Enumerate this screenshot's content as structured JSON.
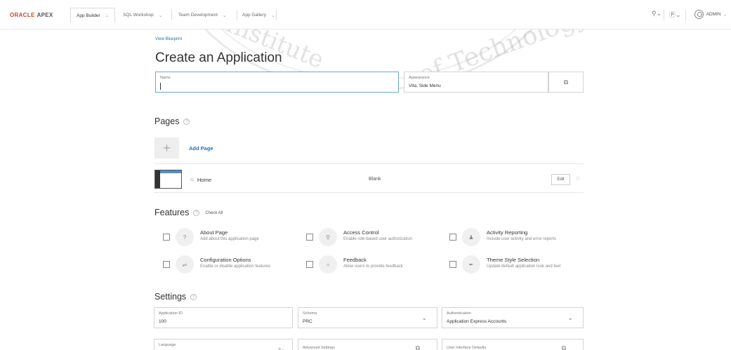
{
  "navbar": {
    "logo": "ORACLE",
    "product": "APEX",
    "tabs": [
      {
        "label": "App Builder",
        "active": true
      },
      {
        "label": "SQL Workshop",
        "active": false
      },
      {
        "label": "Team Development",
        "active": false
      },
      {
        "label": "App Gallery",
        "active": false
      }
    ],
    "user": "ADMIN"
  },
  "watermark": {
    "text_left": "Institute",
    "text_right": "of Technology",
    "small": "s"
  },
  "main": {
    "blueprint_link": "View Blueprint",
    "title": "Create an Application",
    "name_field": {
      "label": "Name",
      "value": ""
    },
    "appearance_field": {
      "label": "Appearance",
      "value": "Vita, Side Menu"
    }
  },
  "pages": {
    "title": "Pages",
    "help": "?",
    "add_label": "Add Page",
    "rows": [
      {
        "name": "Home",
        "type": "Blank",
        "edit_label": "Edit"
      }
    ]
  },
  "features": {
    "title": "Features",
    "help": "?",
    "check_all": "Check All",
    "items": [
      {
        "title": "About Page",
        "desc": "Add about this application page",
        "icon": "question-icon"
      },
      {
        "title": "Access Control",
        "desc": "Enable role-based user authorization",
        "icon": "key-icon"
      },
      {
        "title": "Activity Reporting",
        "desc": "Include user activity and error reports",
        "icon": "user-activity-icon"
      },
      {
        "title": "Configuration Options",
        "desc": "Enable or disable application features",
        "icon": "sliders-icon"
      },
      {
        "title": "Feedback",
        "desc": "Allow users to provide feedback",
        "icon": "comment-icon"
      },
      {
        "title": "Theme Style Selection",
        "desc": "Update default application look and feel",
        "icon": "brush-icon"
      }
    ]
  },
  "settings": {
    "title": "Settings",
    "help": "?",
    "fields": [
      {
        "label": "Application ID",
        "value": "100"
      },
      {
        "label": "Schema",
        "value": "PRC"
      },
      {
        "label": "Authentication",
        "value": "Application Express Accounts"
      },
      {
        "label": "Language",
        "value": ""
      },
      {
        "label": "Advanced Settings",
        "value": ""
      },
      {
        "label": "User Interface Defaults",
        "value": ""
      }
    ]
  }
}
